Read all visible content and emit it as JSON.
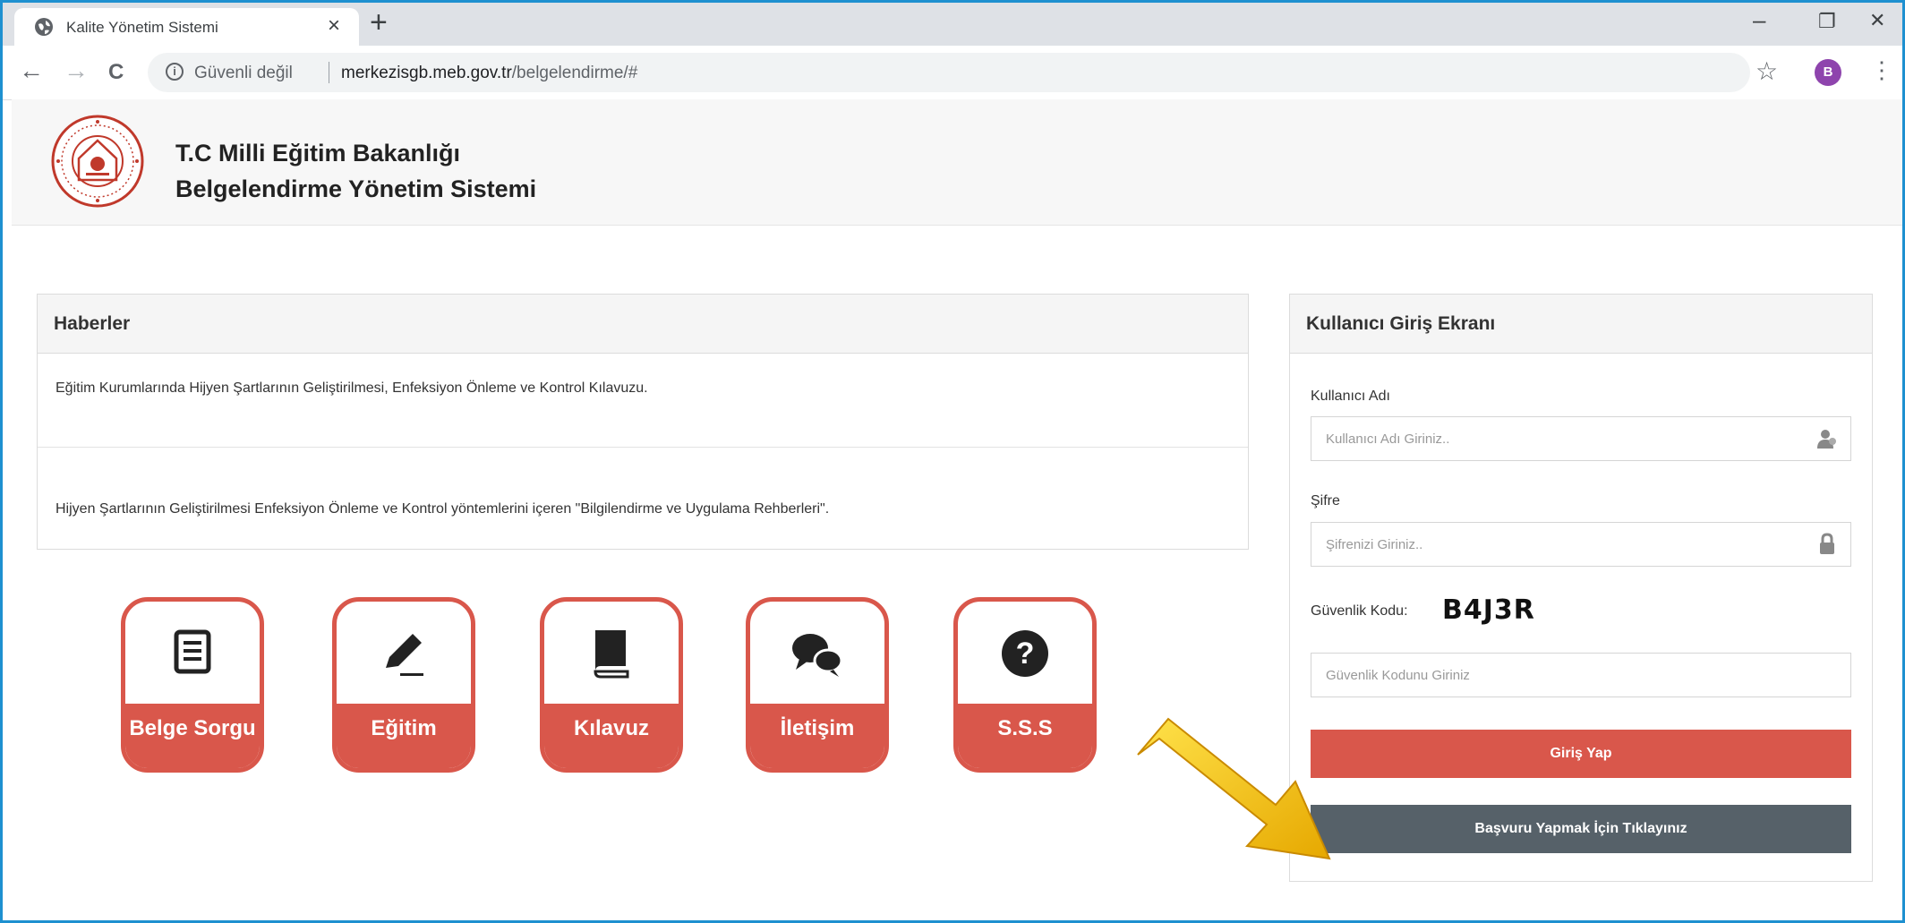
{
  "browser": {
    "tab_title": "Kalite Yönetim Sistemi",
    "tab_close": "×",
    "new_tab": "+",
    "security_label": "Güvenli değil",
    "url_host": "merkezisgb.meb.gov.tr",
    "url_path": "/belgelendirme/#",
    "profile_initial": "B",
    "nav_back": "←",
    "nav_forward": "→",
    "nav_reload": "C",
    "bookmark_star": "☆",
    "menu_dots": "⋮",
    "win_minimize": "–",
    "win_restore": "❐",
    "win_close": "✕"
  },
  "site": {
    "title_line1": "T.C Milli Eğitim Bakanlığı",
    "title_line2": "Belgelendirme Yönetim Sistemi"
  },
  "news": {
    "heading": "Haberler",
    "items": [
      "Eğitim Kurumlarında Hijyen Şartlarının Geliştirilmesi, Enfeksiyon Önleme ve Kontrol Kılavuzu.",
      "Hijyen Şartlarının Geliştirilmesi Enfeksiyon Önleme ve Kontrol yöntemlerini içeren \"Bilgilendirme ve Uygulama Rehberleri\"."
    ]
  },
  "menu_tiles": [
    {
      "label": "Belge Sorgu",
      "icon": "document-icon"
    },
    {
      "label": "Eğitim",
      "icon": "pencil-icon"
    },
    {
      "label": "Kılavuz",
      "icon": "book-icon"
    },
    {
      "label": "İletişim",
      "icon": "chat-icon"
    },
    {
      "label": "S.S.S",
      "icon": "question-icon"
    }
  ],
  "login": {
    "heading": "Kullanıcı Giriş Ekranı",
    "username_label": "Kullanıcı Adı",
    "username_placeholder": "Kullanıcı Adı Giriniz..",
    "password_label": "Şifre",
    "password_placeholder": "Şifrenizi Giriniz..",
    "security_code_label": "Güvenlik Kodu:",
    "security_code_value": "B4J3R",
    "security_code_placeholder": "Güvenlik Kodunu Giriniz",
    "login_button": "Giriş Yap",
    "apply_button": "Başvuru Yapmak İçin Tıklayınız"
  },
  "colors": {
    "accent_red": "#d9574b",
    "apply_gray": "#566169",
    "frame_blue": "#1e90d0",
    "arrow_yellow": "#f5c400"
  }
}
